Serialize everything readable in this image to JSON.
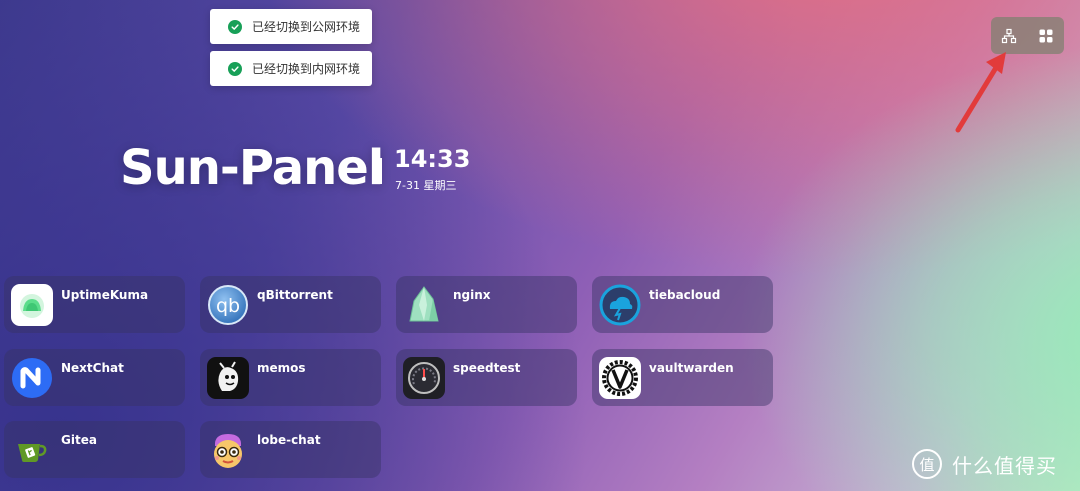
{
  "notifications": [
    {
      "text": "已经切换到公网环境"
    },
    {
      "text": "已经切换到内网环境"
    }
  ],
  "toolbar": {
    "buttons": [
      {
        "name": "network-switch",
        "icon": "network-icon"
      },
      {
        "name": "app-grid",
        "icon": "grid-icon"
      }
    ]
  },
  "header": {
    "title": "Sun-Panel",
    "time": "14:33",
    "date": "7-31 星期三"
  },
  "apps": [
    {
      "name": "UptimeKuma",
      "icon": "uptimekuma-icon"
    },
    {
      "name": "qBittorrent",
      "icon": "qbittorrent-icon"
    },
    {
      "name": "nginx",
      "icon": "nginx-icon"
    },
    {
      "name": "tiebacloud",
      "icon": "tiebacloud-icon"
    },
    {
      "name": "NextChat",
      "icon": "nextchat-icon"
    },
    {
      "name": "memos",
      "icon": "memos-icon"
    },
    {
      "name": "speedtest",
      "icon": "speedtest-icon"
    },
    {
      "name": "vaultwarden",
      "icon": "vaultwarden-icon"
    },
    {
      "name": "Gitea",
      "icon": "gitea-icon"
    },
    {
      "name": "lobe-chat",
      "icon": "lobe-chat-icon"
    }
  ],
  "watermark": {
    "text": "什么值得买"
  },
  "colors": {
    "success": "#18a058",
    "arrow": "#e23b3b"
  }
}
